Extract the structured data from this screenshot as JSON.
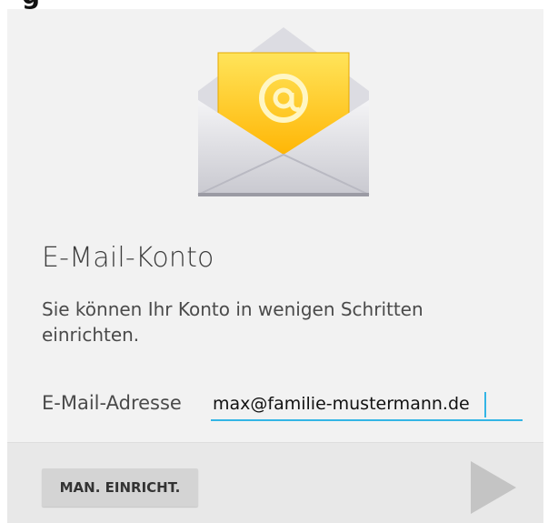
{
  "app": {
    "title": "E-Mail-Konto",
    "description": "Sie können Ihr Konto in wenigen Schritten einrichten.",
    "logo_icon": "email-envelope-at-icon"
  },
  "form": {
    "email_label": "E-Mail-Adresse",
    "email_value": "max@familie-mustermann.de"
  },
  "footer": {
    "manual_setup_label": "MAN. EINRICHT.",
    "next_icon": "play-triangle-icon"
  },
  "colors": {
    "background": "#f2f2f2",
    "accent_underline": "#33b5e5",
    "envelope_yellow": "#ffcc33",
    "footer": "#e8e8e8"
  }
}
